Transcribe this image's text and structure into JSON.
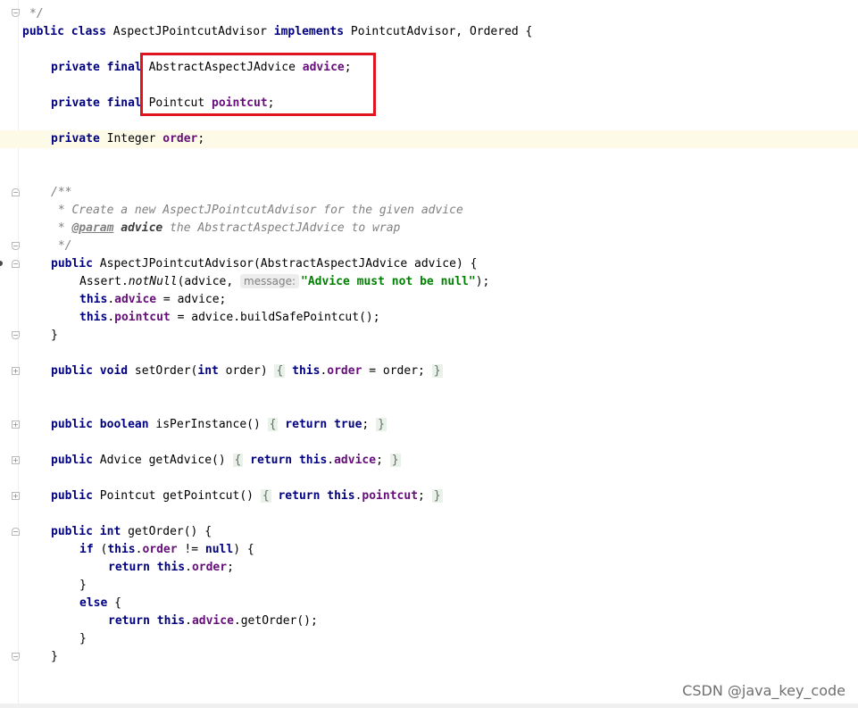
{
  "editor": {
    "header_tail": "*/",
    "class_decl": {
      "kw_public": "public",
      "kw_class": "class",
      "name": " AspectJPointcutAdvisor ",
      "kw_implements": "implements",
      "rest": " PointcutAdvisor, Ordered {"
    },
    "field_advice": {
      "kw": "private final",
      "type": " AbstractAspectJAdvice ",
      "name": "advice",
      "end": ";"
    },
    "field_pointcut": {
      "kw": "private final",
      "type": " Pointcut ",
      "name": "pointcut",
      "end": ";"
    },
    "field_order": {
      "kw": "private",
      "type": " Integer ",
      "name": "order",
      "end": ";"
    },
    "javadoc": {
      "open": "/**",
      "line1": " * Create a new AspectJPointcutAdvisor for the given advice",
      "line2_prefix": " * ",
      "line2_tag": "@param",
      "line2_name": " advice",
      "line2_rest": " the AbstractAspectJAdvice to wrap",
      "close": " */"
    },
    "ctor": {
      "kw": "public",
      "sig": " AspectJPointcutAdvisor(AbstractAspectJAdvice advice) {",
      "assert_pre": "Assert.",
      "assert_method": "notNull",
      "assert_args": "(advice, ",
      "hint": "message:",
      "message": "\"Advice must not be null\"",
      "assert_end": ");",
      "this1": "this",
      "advice_field": "advice",
      "assign1": " = advice;",
      "this2": "this",
      "pointcut_field": "pointcut",
      "assign2": " = advice.buildSafePointcut();",
      "close": "}"
    },
    "set_order": {
      "kw": "public void",
      "sig": " setOrder(",
      "kw_int": "int",
      "params": " order) ",
      "open": "{",
      "this": "this",
      "field": "order",
      "body": " = order; ",
      "close": "}"
    },
    "is_per_instance": {
      "kw": "public boolean",
      "sig": " isPerInstance() ",
      "open": "{",
      "kw_return": " return ",
      "kw_true": "true",
      "end": "; ",
      "close": "}"
    },
    "get_advice": {
      "kw": "public",
      "sig": " Advice getAdvice() ",
      "open": "{",
      "kw_return": " return ",
      "this": "this",
      "field": "advice",
      "end": "; ",
      "close": "}"
    },
    "get_pointcut": {
      "kw": "public",
      "sig": " Pointcut getPointcut() ",
      "open": "{",
      "kw_return": " return ",
      "this": "this",
      "field": "pointcut",
      "end": "; ",
      "close": "}"
    },
    "get_order": {
      "kw": "public int",
      "sig": " getOrder() {",
      "kw_if": "if",
      "if_open": " (",
      "this": "this",
      "field": "order",
      "if_mid": " != ",
      "kw_null": "null",
      "if_close": ") {",
      "kw_return1": "return",
      "this1": " this",
      "field1": "order",
      "end1": ";",
      "close_if": "}",
      "kw_else": "else",
      "else_open": " {",
      "kw_return2": "return",
      "this2": " this",
      "field2": "advice",
      "call": ".getOrder();",
      "close_else": "}",
      "close": "}"
    }
  },
  "watermark": "CSDN @java_key_code",
  "colors": {
    "keyword": "#000080",
    "field": "#660e7a",
    "string": "#008000",
    "comment": "#808080",
    "highlight_box": "#e0141e"
  }
}
